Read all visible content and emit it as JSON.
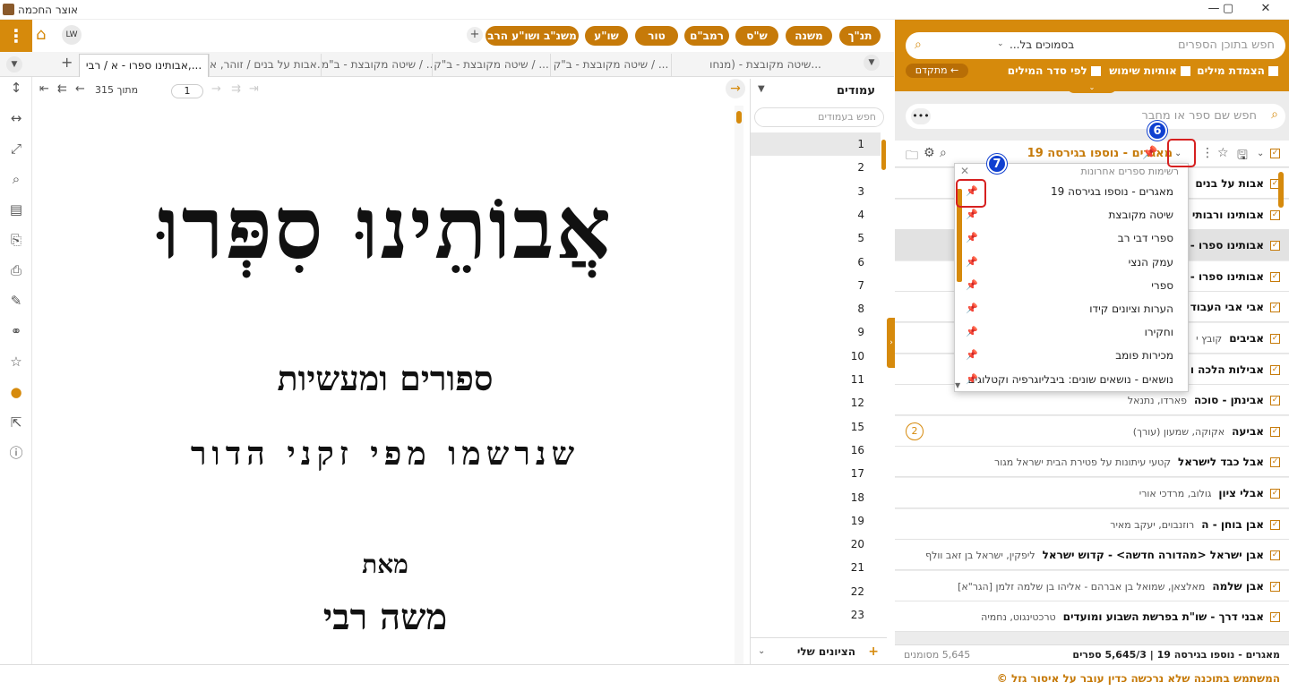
{
  "window": {
    "title": "אוצר החכמה"
  },
  "topbar": {
    "user": "LW",
    "pills": [
      "תנ\"ך",
      "משנה",
      "ש\"ס",
      "רמב\"ם",
      "טור",
      "שו\"ע",
      "משנ\"ב ושו\"ע הרב"
    ]
  },
  "tabs": [
    "אבותינו ספרו - א / רבי,...",
    "אבות על בנים / זוהר, א...",
    "שיטה מקובצת - ב\"מ / ...",
    "שיטה מקובצת - ב\"ק / ...",
    "שיטה מקובצת - ב\"ק / ...",
    "שיטה מקובצת - (מנחו..."
  ],
  "nav": {
    "page": "1",
    "of_label": "מתוך 315"
  },
  "book_page": {
    "title": "אֲבוֹתֵינוּ סִפְּרוּ",
    "subtitle": "ספורים ומעשיות",
    "line3": "שנרשמו מפי זקני הדור",
    "by": "מאת",
    "author": "משה רבי"
  },
  "pages_panel": {
    "header": "עמודים",
    "search_placeholder": "חפש בעמודים",
    "pages": [
      "1",
      "2",
      "3",
      "4",
      "5",
      "6",
      "7",
      "8",
      "9",
      "10",
      "11",
      "12",
      "15",
      "16",
      "17",
      "18",
      "19",
      "20",
      "21",
      "22",
      "23"
    ],
    "bookmarks_label": "הציונים שלי"
  },
  "right": {
    "scope": "בסמוכים בל...",
    "search_placeholder": "חפש בתוכן הספרים",
    "opt1": "הצמדת מילים",
    "opt2": "אותיות שימוש",
    "opt3": "לפי סדר המילים",
    "advanced": "מתקדם",
    "book_search_placeholder": "חפש שם ספר או מחבר",
    "current_list": "מאגרים - נוספו בגירסה 19",
    "books": [
      {
        "title": "אבות על בנים",
        "author": ""
      },
      {
        "title": "אבותינו ורבותי",
        "author": ""
      },
      {
        "title": "אבותינו ספרו -",
        "author": ""
      },
      {
        "title": "אבותינו ספרו -",
        "author": ""
      },
      {
        "title": "אבי אבי העבוד",
        "author": ""
      },
      {
        "title": "אביבים",
        "author": "קובץ י"
      },
      {
        "title": "אבילות הלכה ו",
        "author": ""
      },
      {
        "title": "אבינתן - סוכה",
        "author": "פארדו, נתנאל"
      },
      {
        "title": "אביעה",
        "author": "אקוקה, שמעון (עורך)"
      },
      {
        "title": "אבל כבד לישראל",
        "author": "קטעי עיתונות על פטירת הבית ישראל מגור"
      },
      {
        "title": "אבלי ציון",
        "author": "גולוב, מרדכי אורי"
      },
      {
        "title": "אבן בוחן - ה",
        "author": "רוזנבוים, יעקב מאיר"
      },
      {
        "title": "אבן ישראל <מהדורה חדשה> - קדוש ישראל",
        "author": "ליפקין, ישראל בן זאב וולף"
      },
      {
        "title": "אבן שלמה",
        "author": "מאלצאן, שמואל בן אברהם - אליהו בן שלמה זלמן [הגר\"א]"
      },
      {
        "title": "אבני דרך - שו\"ת בפרשת השבוע ומועדים",
        "author": "טרכטינגוט, נחמיה"
      }
    ],
    "badge": "2",
    "status_left": "5,645 מסומנים",
    "status_right": "מאגרים - נוספו בגירסה 19 | 5,645/3 ספרים"
  },
  "dropdown": {
    "header": "רשימות ספרים אחרונות",
    "items": [
      "מאגרים - נוספו בגירסה 19",
      "שיטה מקובצת",
      "ספרי דבי רב",
      "עמק הנצי",
      "ספרי",
      "הערות וציונים קידו",
      "וחקירו",
      "מכירות פומב",
      "נושאים - נושאים שונים: ביבליוגרפיה וקטלוגים"
    ]
  },
  "steps": [
    "6",
    "7"
  ],
  "footer": {
    "message": "המשתמש בתוכנה שלא נרכשה כדין עובר על איסור גזל ©"
  }
}
